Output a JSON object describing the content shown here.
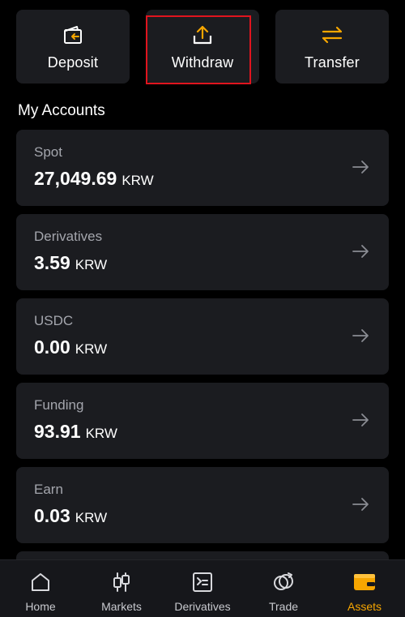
{
  "actions": {
    "deposit_label": "Deposit",
    "withdraw_label": "Withdraw",
    "transfer_label": "Transfer"
  },
  "section_title": "My Accounts",
  "accounts": [
    {
      "name": "Spot",
      "amount": "27,049.69",
      "currency": "KRW"
    },
    {
      "name": "Derivatives",
      "amount": "3.59",
      "currency": "KRW"
    },
    {
      "name": "USDC",
      "amount": "0.00",
      "currency": "KRW"
    },
    {
      "name": "Funding",
      "amount": "93.91",
      "currency": "KRW"
    },
    {
      "name": "Earn",
      "amount": "0.03",
      "currency": "KRW"
    }
  ],
  "nav": {
    "items": [
      {
        "label": "Home",
        "icon": "home-icon"
      },
      {
        "label": "Markets",
        "icon": "candlestick-icon"
      },
      {
        "label": "Derivatives",
        "icon": "derivatives-icon"
      },
      {
        "label": "Trade",
        "icon": "trade-icon"
      },
      {
        "label": "Assets",
        "icon": "wallet-icon"
      }
    ],
    "active": "Assets"
  },
  "colors": {
    "accent": "#f7a600",
    "card_bg": "#1b1c20",
    "highlight": "#e0141e",
    "muted_text": "#a4a6ad"
  }
}
